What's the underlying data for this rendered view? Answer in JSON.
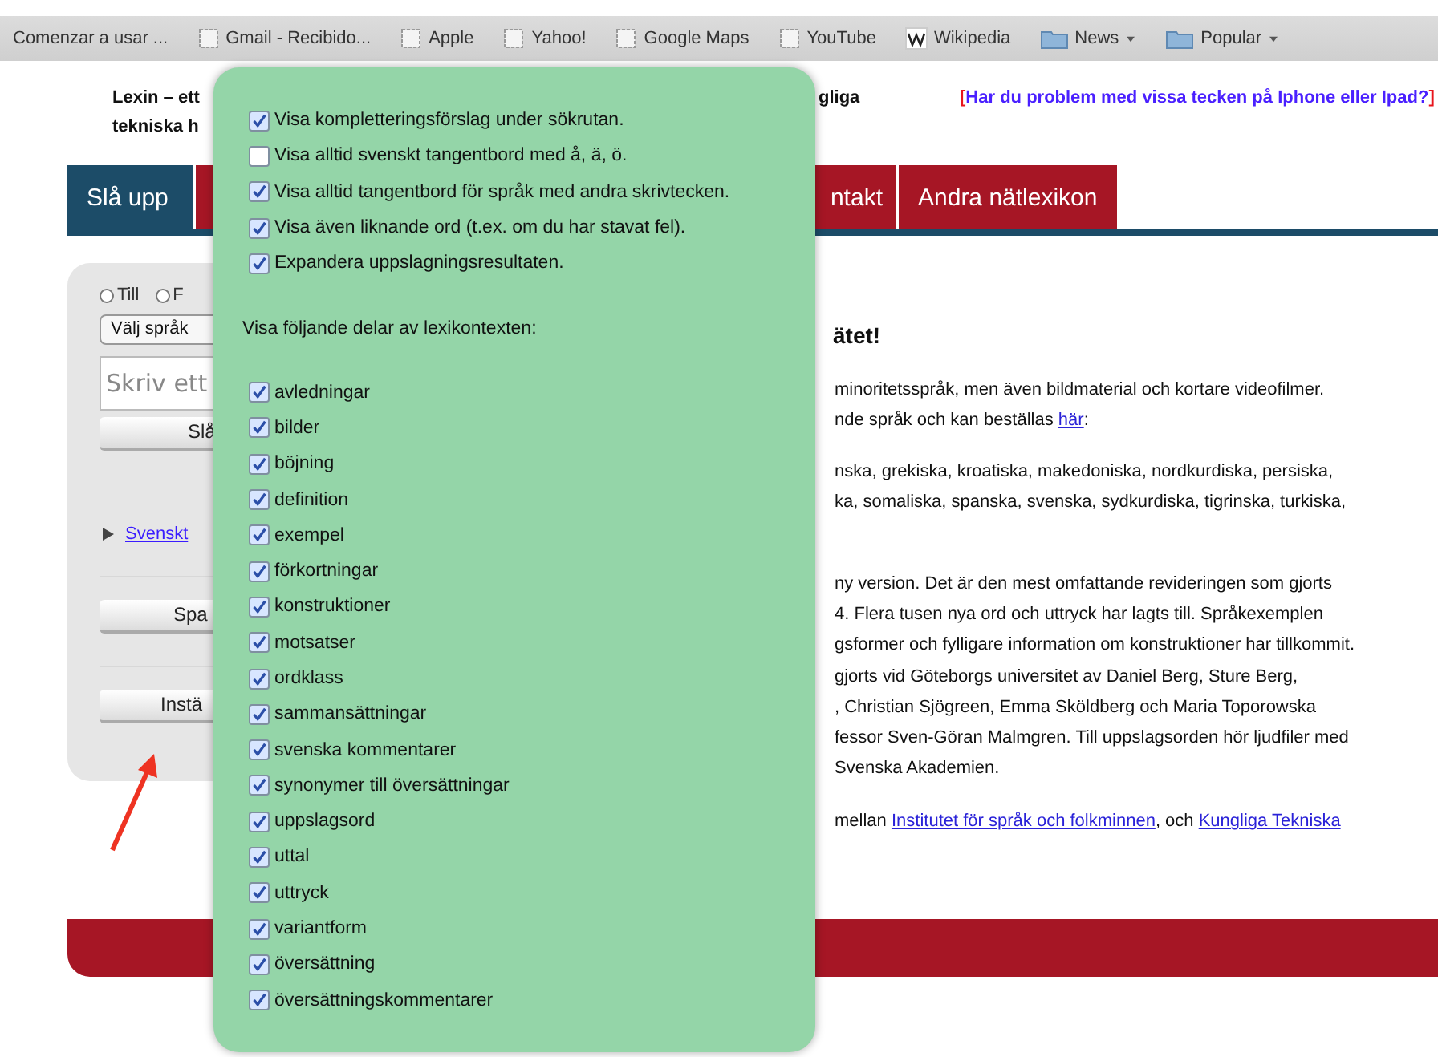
{
  "bookmarks": [
    {
      "label": "Comenzar a usar ...",
      "kind": "text",
      "menu": false
    },
    {
      "label": "Gmail - Recibido...",
      "kind": "page",
      "menu": false
    },
    {
      "label": "Apple",
      "kind": "page",
      "menu": false
    },
    {
      "label": "Yahoo!",
      "kind": "page",
      "menu": false
    },
    {
      "label": "Google Maps",
      "kind": "page",
      "menu": false
    },
    {
      "label": "YouTube",
      "kind": "page",
      "menu": false
    },
    {
      "label": "Wikipedia",
      "kind": "wiki",
      "menu": false
    },
    {
      "label": "News",
      "kind": "folder",
      "menu": true
    },
    {
      "label": "Popular",
      "kind": "folder",
      "menu": true
    }
  ],
  "header": {
    "title_lines": [
      "Lexin – ett",
      "tekniska h"
    ],
    "fragment": "gliga",
    "notice": {
      "open": "[",
      "text": "Har du problem med vissa tecken på Iphone eller Ipad?",
      "close": "]"
    }
  },
  "tabs": [
    {
      "label": "Slå upp",
      "selected": true
    },
    {
      "label": "ntakt",
      "selected": false
    },
    {
      "label": "Andra nätlexikon",
      "selected": false
    }
  ],
  "side": {
    "radios": [
      {
        "label": "Till",
        "selected": false
      },
      {
        "label": "F",
        "selected": false
      }
    ],
    "select": "Välj språk",
    "input": {
      "placeholder": "Skriv ett"
    },
    "buttons": [
      "Slå",
      "Spa",
      "Instä"
    ],
    "link": {
      "label": "Svenskt",
      "expanded": false
    }
  },
  "main": {
    "heading": "ätet!",
    "paragraphs": [
      [
        [
          {
            "text": "minoritetsspråk, men även bildmaterial och kortare videofilmer."
          }
        ],
        [
          {
            "text": "nde språk och kan beställas "
          },
          {
            "text": "här",
            "link": true
          },
          {
            "text": ":"
          }
        ]
      ],
      [
        [
          {
            "text": "nska, grekiska, kroatiska, makedoniska, nordkurdiska, persiska,"
          }
        ],
        [
          {
            "text": "ka, somaliska, spanska, svenska, sydkurdiska, tigrinska, turkiska,"
          }
        ]
      ],
      [
        [
          {
            "text": "ny version. Det är den mest omfattande revideringen som gjorts"
          }
        ],
        [
          {
            "text": "4. Flera tusen nya ord och uttryck har lagts till. Språkexemplen"
          }
        ],
        [
          {
            "text": "gsformer och fylligare information om konstruktioner har tillkommit."
          }
        ],
        [
          {
            "text": "gjorts vid Göteborgs universitet av Daniel Berg, Sture Berg,"
          }
        ],
        [
          {
            "text": ", Christian Sjögreen, Emma Sköldberg och Maria Toporowska"
          }
        ],
        [
          {
            "text": "fessor Sven-Göran Malmgren. Till uppslagsorden hör ljudfiler med"
          }
        ],
        [
          {
            "text": "Svenska Akademien."
          }
        ]
      ],
      [
        [
          {
            "text": "mellan "
          },
          {
            "text": "Institutet för språk och folkminnen",
            "link": true
          },
          {
            "text": ", och "
          },
          {
            "text": "Kungliga Tekniska",
            "link": true
          }
        ]
      ]
    ]
  },
  "settings": {
    "options": [
      {
        "label": "Visa kompletteringsförslag under sökrutan.",
        "checked": true
      },
      {
        "label": "Visa alltid svenskt tangentbord med å, ä, ö.",
        "checked": false
      },
      {
        "label": "Visa alltid tangentbord för språk med andra skrivtecken.",
        "checked": true
      },
      {
        "label": "Visa även liknande ord (t.ex. om du har stavat fel).",
        "checked": true
      },
      {
        "label": "Expandera uppslagningsresultaten.",
        "checked": true
      }
    ],
    "section": "Visa följande delar av lexikontexten:",
    "parts": [
      {
        "label": "avledningar",
        "checked": true
      },
      {
        "label": "bilder",
        "checked": true
      },
      {
        "label": "böjning",
        "checked": true
      },
      {
        "label": "definition",
        "checked": true
      },
      {
        "label": "exempel",
        "checked": true
      },
      {
        "label": "förkortningar",
        "checked": true
      },
      {
        "label": "konstruktioner",
        "checked": true
      },
      {
        "label": "motsatser",
        "checked": true
      },
      {
        "label": "ordklass",
        "checked": true
      },
      {
        "label": "sammansättningar",
        "checked": true
      },
      {
        "label": "svenska kommentarer",
        "checked": true
      },
      {
        "label": "synonymer till översättningar",
        "checked": true
      },
      {
        "label": "uppslagsord",
        "checked": true
      },
      {
        "label": "uttal",
        "checked": true
      },
      {
        "label": "uttryck",
        "checked": true
      },
      {
        "label": "variantform",
        "checked": true
      },
      {
        "label": "översättning",
        "checked": true
      },
      {
        "label": "översättningskommentarer",
        "checked": true
      }
    ]
  }
}
